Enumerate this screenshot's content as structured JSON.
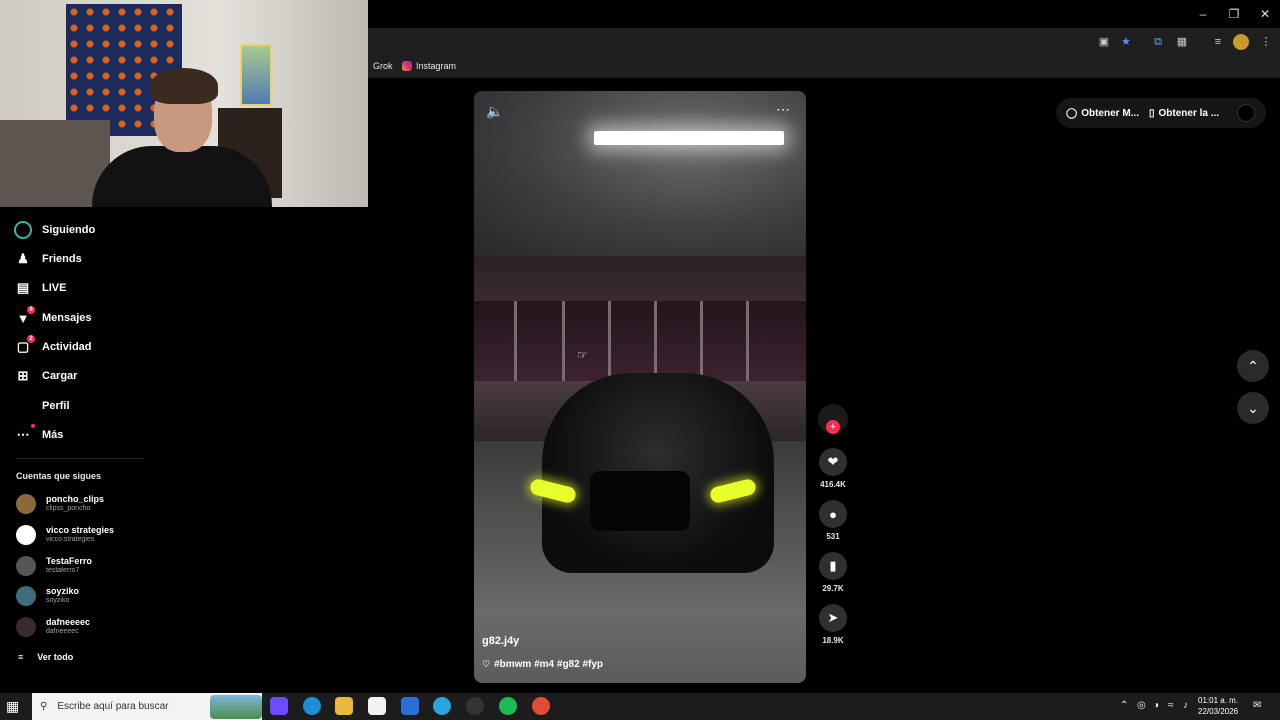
{
  "browser": {
    "bookmarks": [
      "Grok",
      "Instagram"
    ],
    "window_controls": [
      "minimize",
      "restore",
      "close"
    ]
  },
  "sidebar": {
    "nav": [
      {
        "label": "Siguiendo",
        "icon": "following-icon"
      },
      {
        "label": "Friends",
        "icon": "friends-icon"
      },
      {
        "label": "LIVE",
        "icon": "live-icon"
      },
      {
        "label": "Mensajes",
        "icon": "messages-icon",
        "badge": "9"
      },
      {
        "label": "Actividad",
        "icon": "activity-icon",
        "badge": "2"
      },
      {
        "label": "Cargar",
        "icon": "upload-icon"
      },
      {
        "label": "Perfil",
        "icon": "profile-icon"
      },
      {
        "label": "Más",
        "icon": "more-icon"
      }
    ],
    "following_title": "Cuentas que sigues",
    "accounts": [
      {
        "name": "poncho_clips",
        "handle": "clipss_poncho",
        "color": "#8a6a3a"
      },
      {
        "name": "vicco strategies",
        "handle": "vicco.strategies",
        "color": "#ffffff"
      },
      {
        "name": "TestaFerro",
        "handle": "testaferro7",
        "color": "#555555"
      },
      {
        "name": "soyziko",
        "handle": "soyziko",
        "color": "#3f6e7a"
      },
      {
        "name": "dafneeeec",
        "handle": "dafneeeec",
        "color": "#3a2a2e"
      }
    ],
    "see_all": "Ver todo"
  },
  "video": {
    "author": "g82.j4y",
    "caption": "#bmwm #m4 #g82 #fyp"
  },
  "actions": {
    "likes": "416.4K",
    "comments": "531",
    "saves": "29.7K",
    "shares": "18.9K"
  },
  "top_right": {
    "coins_label": "Obtener M...",
    "app_label": "Obtener la ..."
  },
  "taskbar": {
    "search_placeholder": "Escribe aquí para buscar",
    "time": "01:01 a. m.",
    "date": "22/03/2026"
  },
  "colors": {
    "accent": "#fe2c55",
    "headlight": "#e9ff2c"
  }
}
